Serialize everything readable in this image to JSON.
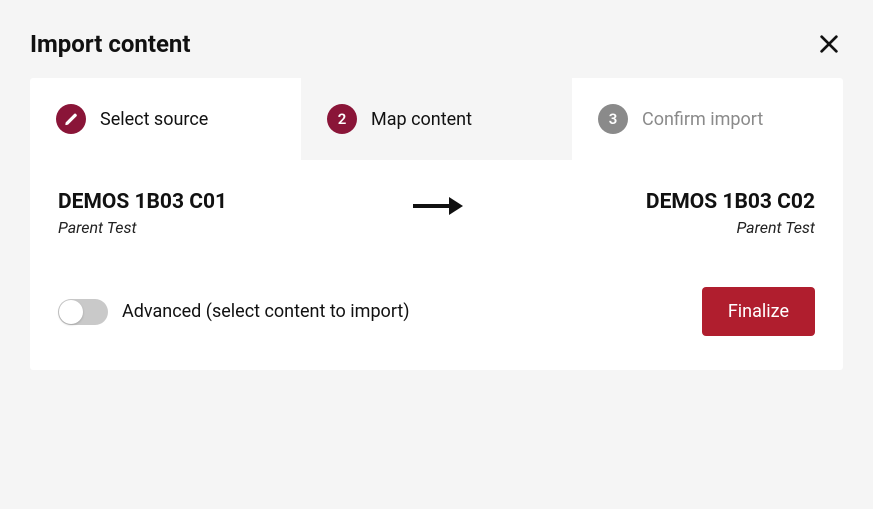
{
  "header": {
    "title": "Import content"
  },
  "steps": [
    {
      "label": "Select source",
      "state": "done",
      "marker": "icon-pencil"
    },
    {
      "label": "Map content",
      "state": "current",
      "marker": "2"
    },
    {
      "label": "Confirm import",
      "state": "upcoming",
      "marker": "3"
    }
  ],
  "map": {
    "source": {
      "title": "DEMOS 1B03 C01",
      "subtitle": "Parent Test"
    },
    "destination": {
      "title": "DEMOS 1B03 C02",
      "subtitle": "Parent Test"
    }
  },
  "footer": {
    "advanced_label": "Advanced (select content to import)",
    "advanced_on": false,
    "finalize_label": "Finalize"
  }
}
